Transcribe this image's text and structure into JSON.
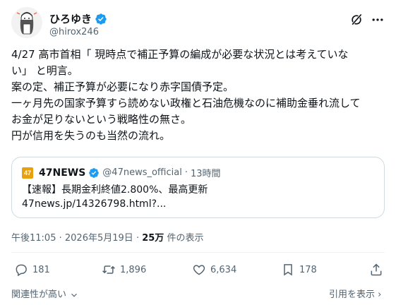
{
  "user": {
    "display_name": "ひろゆき",
    "handle": "@hirox246"
  },
  "post": {
    "lines": [
      "4/27 高市首相「 現時点で補正予算の編成が必要な状況とは考えていな",
      "い」 と明言。",
      "案の定、補正予算が必要になり赤字国債予定。",
      "一ヶ月先の国家予算すら読めない政権と石油危機なのに補助金垂れ流して",
      "お金が足りないという戦略性の無さ。",
      "円が信用を失うのも当然の流れ。"
    ]
  },
  "quote": {
    "logo_text": "47",
    "name": "47NEWS",
    "handle": "@47news_official",
    "separator": "·",
    "time": "13時間",
    "text": "【速報】長期金利終値2.800%、最高更新",
    "link": "47news.jp/14326798.html?..."
  },
  "meta": {
    "time": "午後11:05",
    "dot": "·",
    "date": "2026年5月19日",
    "views_count": "25万",
    "views_label": "件の表示"
  },
  "actions": {
    "replies": "181",
    "reposts": "1,896",
    "likes": "6,634",
    "bookmarks": "178"
  },
  "footer": {
    "relevance": "関連性が高い",
    "quotes_link": "引用を表示",
    "arrow": "›"
  },
  "colors": {
    "verified": "#1d9bf0",
    "muted": "#536471",
    "text": "#0f1419",
    "logo": "#e8a010"
  }
}
